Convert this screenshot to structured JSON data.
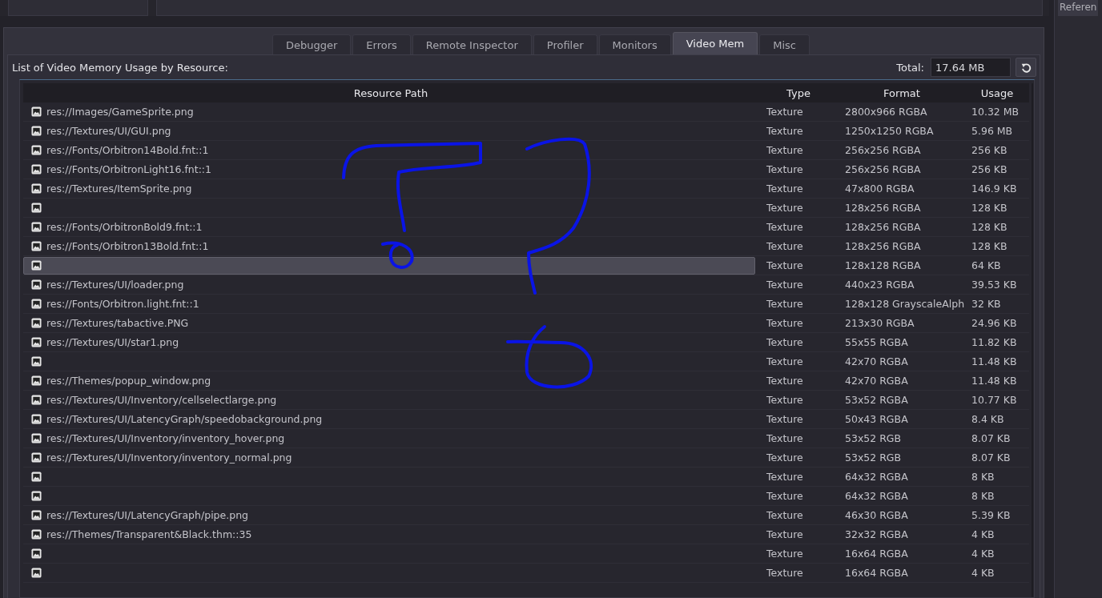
{
  "side_tab": {
    "label": "Referen"
  },
  "tabs": [
    {
      "label": "Debugger",
      "selected": false
    },
    {
      "label": "Errors",
      "selected": false
    },
    {
      "label": "Remote Inspector",
      "selected": false
    },
    {
      "label": "Profiler",
      "selected": false
    },
    {
      "label": "Monitors",
      "selected": false
    },
    {
      "label": "Video Mem",
      "selected": true
    },
    {
      "label": "Misc",
      "selected": false
    }
  ],
  "heading": "List of Video Memory Usage by Resource:",
  "total": {
    "label": "Total:",
    "value": "17.64 MB"
  },
  "table": {
    "columns": [
      "Resource Path",
      "Type",
      "Format",
      "Usage"
    ],
    "rows": [
      {
        "path": "res://Images/GameSprite.png",
        "type": "Texture",
        "format": "2800x966 RGBA",
        "usage": "10.32 MB",
        "selected": false
      },
      {
        "path": "res://Textures/UI/GUI.png",
        "type": "Texture",
        "format": "1250x1250 RGBA",
        "usage": "5.96 MB",
        "selected": false
      },
      {
        "path": "res://Fonts/Orbitron14Bold.fnt::1",
        "type": "Texture",
        "format": "256x256 RGBA",
        "usage": "256 KB",
        "selected": false
      },
      {
        "path": "res://Fonts/OrbitronLight16.fnt::1",
        "type": "Texture",
        "format": "256x256 RGBA",
        "usage": "256 KB",
        "selected": false
      },
      {
        "path": "res://Textures/ItemSprite.png",
        "type": "Texture",
        "format": "47x800 RGBA",
        "usage": "146.9 KB",
        "selected": false
      },
      {
        "type": "Texture",
        "format": "128x256 RGBA",
        "usage": "128 KB",
        "selected": false
      },
      {
        "path": "res://Fonts/OrbitronBold9.fnt::1",
        "type": "Texture",
        "format": "128x256 RGBA",
        "usage": "128 KB",
        "selected": false
      },
      {
        "path": "res://Fonts/Orbitron13Bold.fnt::1",
        "type": "Texture",
        "format": "128x256 RGBA",
        "usage": "128 KB",
        "selected": false
      },
      {
        "type": "Texture",
        "format": "128x128 RGBA",
        "usage": "64 KB",
        "selected": true
      },
      {
        "path": "res://Textures/UI/loader.png",
        "type": "Texture",
        "format": "440x23 RGBA",
        "usage": "39.53 KB",
        "selected": false
      },
      {
        "path": "res://Fonts/Orbitron.light.fnt::1",
        "type": "Texture",
        "format": "128x128 GrayscaleAlph",
        "usage": "32 KB",
        "selected": false
      },
      {
        "path": "res://Textures/tabactive.PNG",
        "type": "Texture",
        "format": "213x30 RGBA",
        "usage": "24.96 KB",
        "selected": false
      },
      {
        "path": "res://Textures/UI/star1.png",
        "type": "Texture",
        "format": "55x55 RGBA",
        "usage": "11.82 KB",
        "selected": false
      },
      {
        "type": "Texture",
        "format": "42x70 RGBA",
        "usage": "11.48 KB",
        "selected": false
      },
      {
        "path": "res://Themes/popup_window.png",
        "type": "Texture",
        "format": "42x70 RGBA",
        "usage": "11.48 KB",
        "selected": false
      },
      {
        "path": "res://Textures/UI/Inventory/cellselectlarge.png",
        "type": "Texture",
        "format": "53x52 RGBA",
        "usage": "10.77 KB",
        "selected": false
      },
      {
        "path": "res://Textures/UI/LatencyGraph/speedobackground.png",
        "type": "Texture",
        "format": "50x43 RGBA",
        "usage": "8.4 KB",
        "selected": false
      },
      {
        "path": "res://Textures/UI/Inventory/inventory_hover.png",
        "type": "Texture",
        "format": "53x52 RGB",
        "usage": "8.07 KB",
        "selected": false
      },
      {
        "path": "res://Textures/UI/Inventory/inventory_normal.png",
        "type": "Texture",
        "format": "53x52 RGB",
        "usage": "8.07 KB",
        "selected": false
      },
      {
        "type": "Texture",
        "format": "64x32 RGBA",
        "usage": "8 KB",
        "selected": false
      },
      {
        "type": "Texture",
        "format": "64x32 RGBA",
        "usage": "8 KB",
        "selected": false
      },
      {
        "path": "res://Textures/UI/LatencyGraph/pipe.png",
        "type": "Texture",
        "format": "46x30 RGBA",
        "usage": "5.39 KB",
        "selected": false
      },
      {
        "path": "res://Themes/Transparent&Black.thm::35",
        "type": "Texture",
        "format": "32x32 RGBA",
        "usage": "4 KB",
        "selected": false
      },
      {
        "type": "Texture",
        "format": "16x64 RGBA",
        "usage": "4 KB",
        "selected": false
      },
      {
        "type": "Texture",
        "format": "16x64 RGBA",
        "usage": "4 KB",
        "selected": false
      }
    ]
  }
}
